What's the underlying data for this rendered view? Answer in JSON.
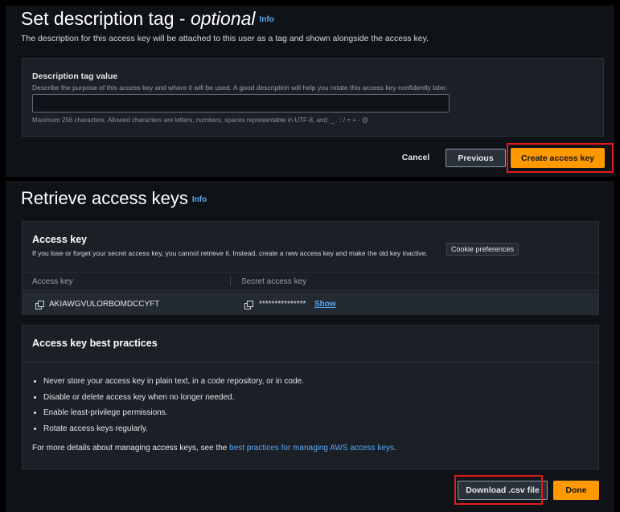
{
  "description_section": {
    "title": "Set description tag - ",
    "title_optional": "optional",
    "info": "Info",
    "subtitle": "The description for this access key will be attached to this user as a tag and shown alongside the access key.",
    "field_label": "Description tag value",
    "field_hint": "Describe the purpose of this access key and where it will be used. A good description will help you rotate this access key confidently later.",
    "field_value": "",
    "field_constraint": "Maximum 256 characters. Allowed characters are letters, numbers, spaces representable in UTF-8, and: _ . : / = + - @"
  },
  "actions": {
    "cancel": "Cancel",
    "previous": "Previous",
    "create": "Create access key"
  },
  "retrieve_section": {
    "title": "Retrieve access keys",
    "info": "Info",
    "access_key_card": {
      "heading": "Access key",
      "description": "If you lose or forget your secret access key, you cannot retrieve it. Instead, create a new access key and make the old key inactive.",
      "cookie_label": "Cookie preferences",
      "columns": [
        "Access key",
        "Secret access key"
      ],
      "access_key_value": "AKIAWGVULORBOMDCCYFT",
      "secret_masked": "***************",
      "show_label": "Show"
    },
    "best_practices": {
      "heading": "Access key best practices",
      "items": [
        "Never store your access key in plain text, in a code repository, or in code.",
        "Disable or delete access key when no longer needed.",
        "Enable least-privilege permissions.",
        "Rotate access keys regularly."
      ],
      "more_prefix": "For more details about managing access keys, see the ",
      "more_link": "best practices for managing AWS access keys",
      "more_suffix": "."
    }
  },
  "footer": {
    "download": "Download .csv file",
    "done": "Done"
  },
  "colors": {
    "primary": "#ff9900",
    "link": "#59a9f7",
    "highlight": "#e11b1b",
    "background": "#0f1216"
  }
}
